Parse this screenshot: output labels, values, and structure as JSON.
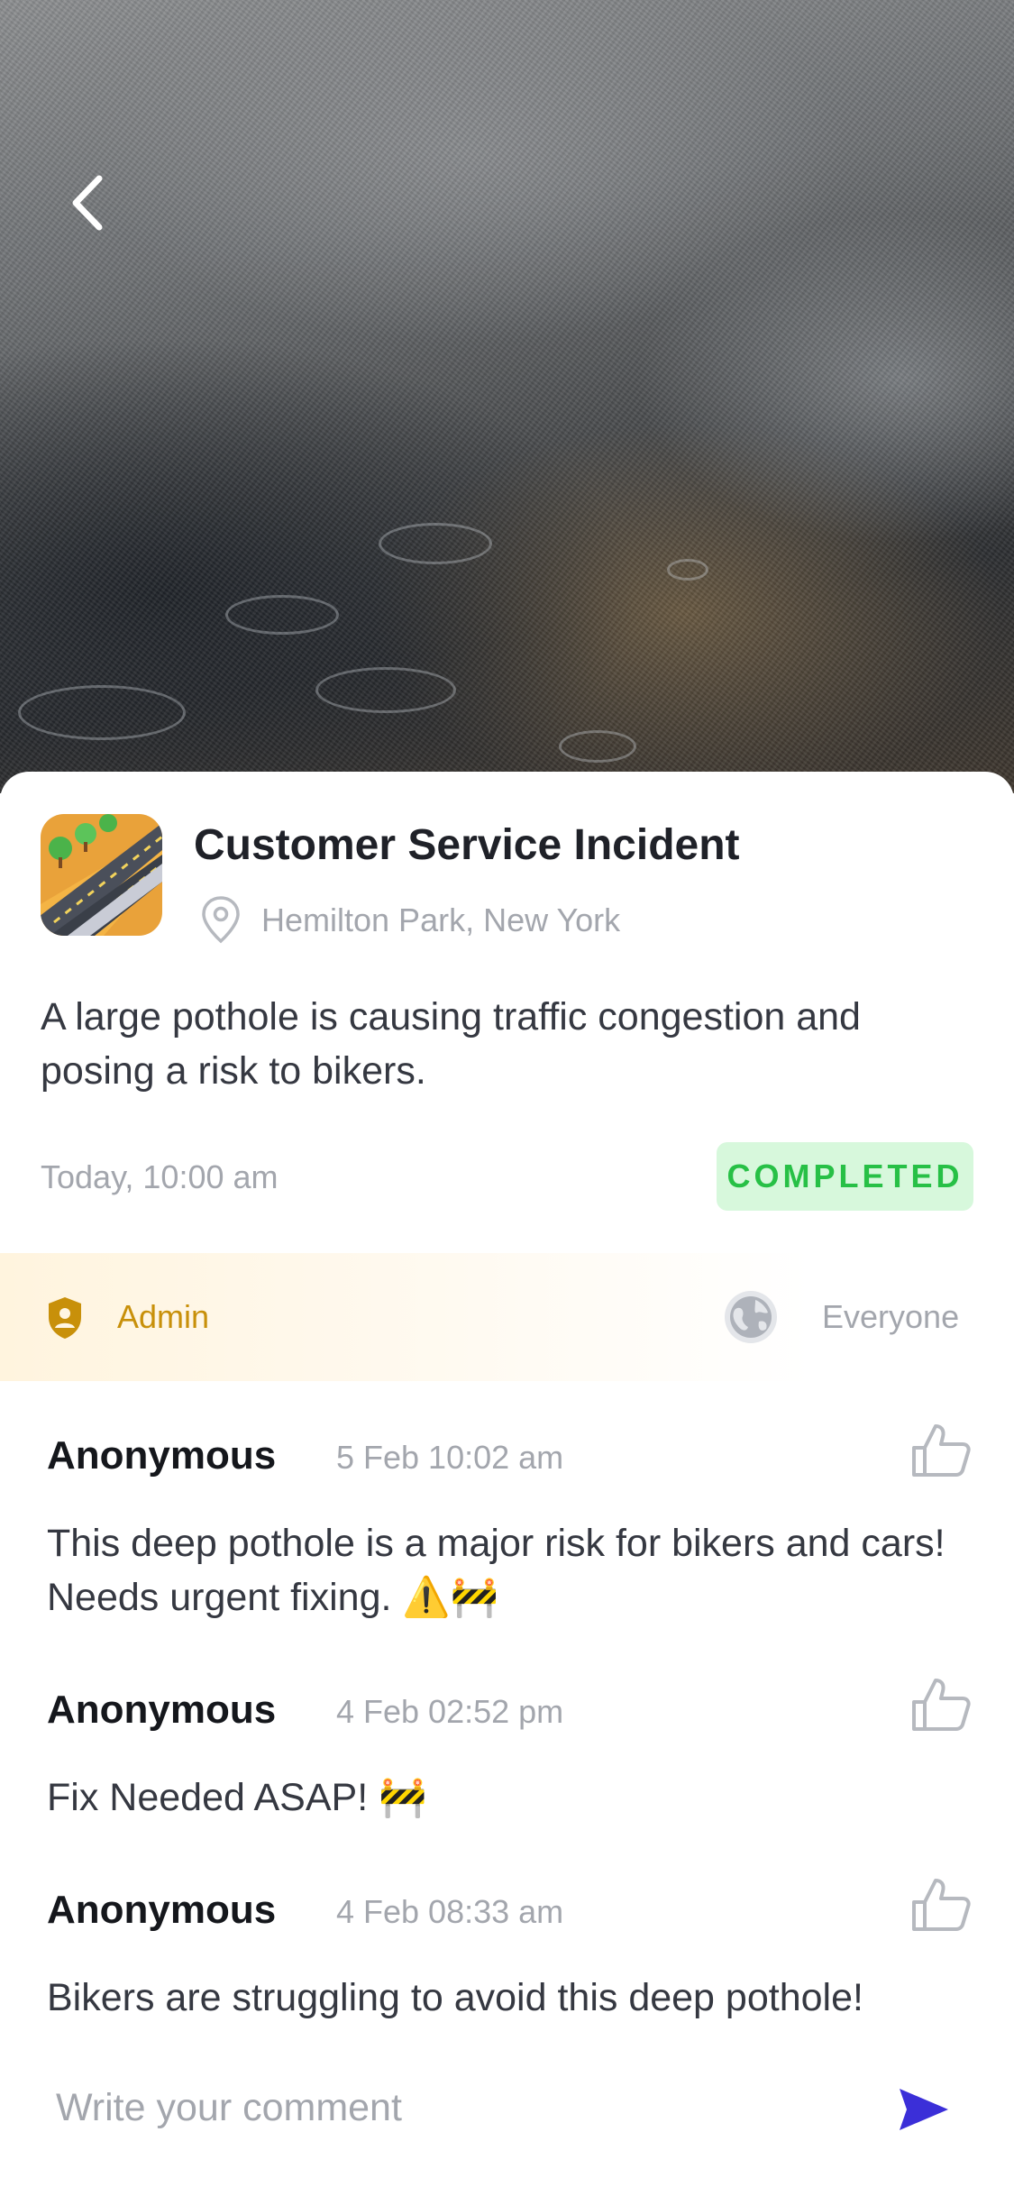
{
  "incident": {
    "title": "Customer Service Incident",
    "location": "Hemilton Park, New York",
    "description": "A large pothole is causing traffic congestion and posing a risk to bikers.",
    "date": "Today, 10:00 am",
    "status": "COMPLETED"
  },
  "visibility": {
    "author_role": "Admin",
    "audience": "Everyone"
  },
  "comments": [
    {
      "author": "Anonymous",
      "time": "5 Feb 10:02 am",
      "text": "This deep pothole is a major risk for bikers and cars! Needs urgent fixing. ⚠️🚧"
    },
    {
      "author": "Anonymous",
      "time": "4 Feb 02:52 pm",
      "text": "Fix Needed ASAP! 🚧"
    },
    {
      "author": "Anonymous",
      "time": "4 Feb 08:33 am",
      "text": "Bikers are struggling to avoid this deep pothole!"
    }
  ],
  "composer": {
    "placeholder": "Write your comment"
  },
  "icons": {
    "back": "chevron-left-icon",
    "location": "map-pin-icon",
    "admin": "shield-user-icon",
    "audience": "globe-icon",
    "like": "thumbs-up-icon",
    "send": "send-icon"
  },
  "colors": {
    "status_bg": "#d7f8dc",
    "status_text": "#27c046",
    "admin_accent": "#c8900a",
    "send_accent": "#3b2fd8"
  }
}
